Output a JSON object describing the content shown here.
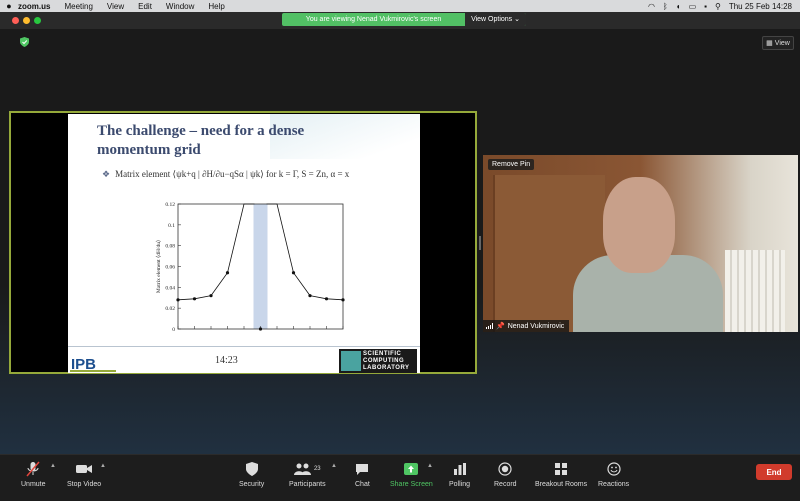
{
  "menubar": {
    "app_name": "zoom.us",
    "items": [
      "Meeting",
      "View",
      "Edit",
      "Window",
      "Help"
    ],
    "datetime": "Thu 25 Feb  14:28"
  },
  "banner": {
    "message": "You are viewing Nenad Vukmirovic's screen",
    "view_options": "View Options ⌄"
  },
  "view_button": "View",
  "slide": {
    "title_line1": "The challenge – need for a dense",
    "title_line2": "momentum grid",
    "bullet": "Matrix element ⟨ψk+q | ∂H/∂u−qSα | ψk⟩ for k = Γ, S = Zn, α = x",
    "time": "14:23",
    "logo_left": "IPB",
    "logo_right_lines": [
      "SCIENTIFIC",
      "COMPUTING",
      "LABORATORY"
    ]
  },
  "chart_data": {
    "type": "line",
    "ylabel": "Matrix element ⟨dH/du⟩",
    "ylim": [
      0,
      0.12
    ],
    "yticks": [
      "0",
      "0.02",
      "0.04",
      "0.06",
      "0.08",
      "0.1",
      "0.12"
    ],
    "x": [
      -5,
      -4,
      -3,
      -2,
      -1,
      0,
      1,
      2,
      3,
      4,
      5
    ],
    "values": [
      0.028,
      0.029,
      0.032,
      0.054,
      0.12,
      0.0,
      0.12,
      0.054,
      0.032,
      0.029,
      0.028
    ]
  },
  "video": {
    "remove_pin": "Remove Pin",
    "name": "Nenad Vukmirovic"
  },
  "toolbar": {
    "unmute": "Unmute",
    "stop_video": "Stop Video",
    "security": "Security",
    "participants": "Participants",
    "participants_count": "23",
    "chat": "Chat",
    "share_screen": "Share Screen",
    "polling": "Polling",
    "record": "Record",
    "breakout_rooms": "Breakout Rooms",
    "reactions": "Reactions",
    "end": "End"
  },
  "colors": {
    "share_border": "#95a93a",
    "banner": "#52c065",
    "end_button": "#d13b2c"
  }
}
